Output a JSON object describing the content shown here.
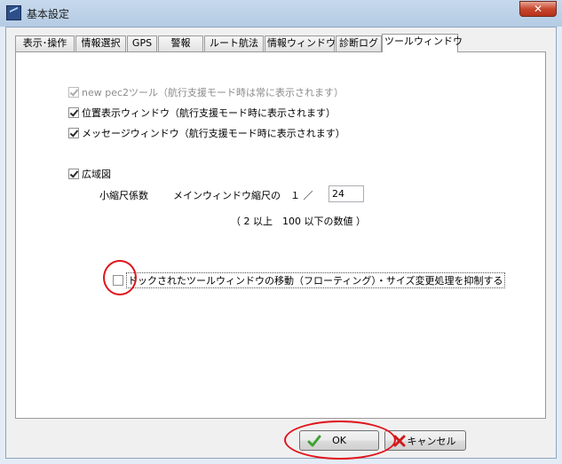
{
  "window": {
    "title": "基本設定",
    "close_label": "✕"
  },
  "tabs": [
    {
      "label": "表示･操作",
      "active": false
    },
    {
      "label": "情報選択",
      "active": false
    },
    {
      "label": "GPS",
      "active": false
    },
    {
      "label": "警報",
      "active": false
    },
    {
      "label": "ルート航法",
      "active": false
    },
    {
      "label": "情報ウィンドウ",
      "active": false
    },
    {
      "label": "診断ログ",
      "active": false
    },
    {
      "label": "ツールウィンドウ",
      "active": true
    }
  ],
  "panel": {
    "checkboxes": [
      {
        "label": "new pec2ツール（航行支援モード時は常に表示されます）",
        "checked": true,
        "enabled": false
      },
      {
        "label": "位置表示ウィンドウ（航行支援モード時に表示されます）",
        "checked": true,
        "enabled": true
      },
      {
        "label": "メッセージウィンドウ（航行支援モード時に表示されます）",
        "checked": true,
        "enabled": true
      },
      {
        "label": "広域図",
        "checked": true,
        "enabled": true
      }
    ],
    "scale": {
      "label": "小縮尺係数",
      "main_label": "メインウィンドウ縮尺の　１ ／",
      "value": "24",
      "hint": "（ 2 以上　100 以下の数値 ）"
    },
    "dock": {
      "label": "ドックされたツールウィンドウの移動（フローティング）・サイズ変更処理を抑制する",
      "checked": false
    }
  },
  "buttons": {
    "ok": "OK",
    "cancel": "キャンセル"
  },
  "colors": {
    "annotation": "#e0141c",
    "ok_icon": "#3fa230",
    "cancel_icon": "#cc1b1b"
  },
  "icons": {
    "ok": "check-icon",
    "cancel": "x-icon"
  }
}
